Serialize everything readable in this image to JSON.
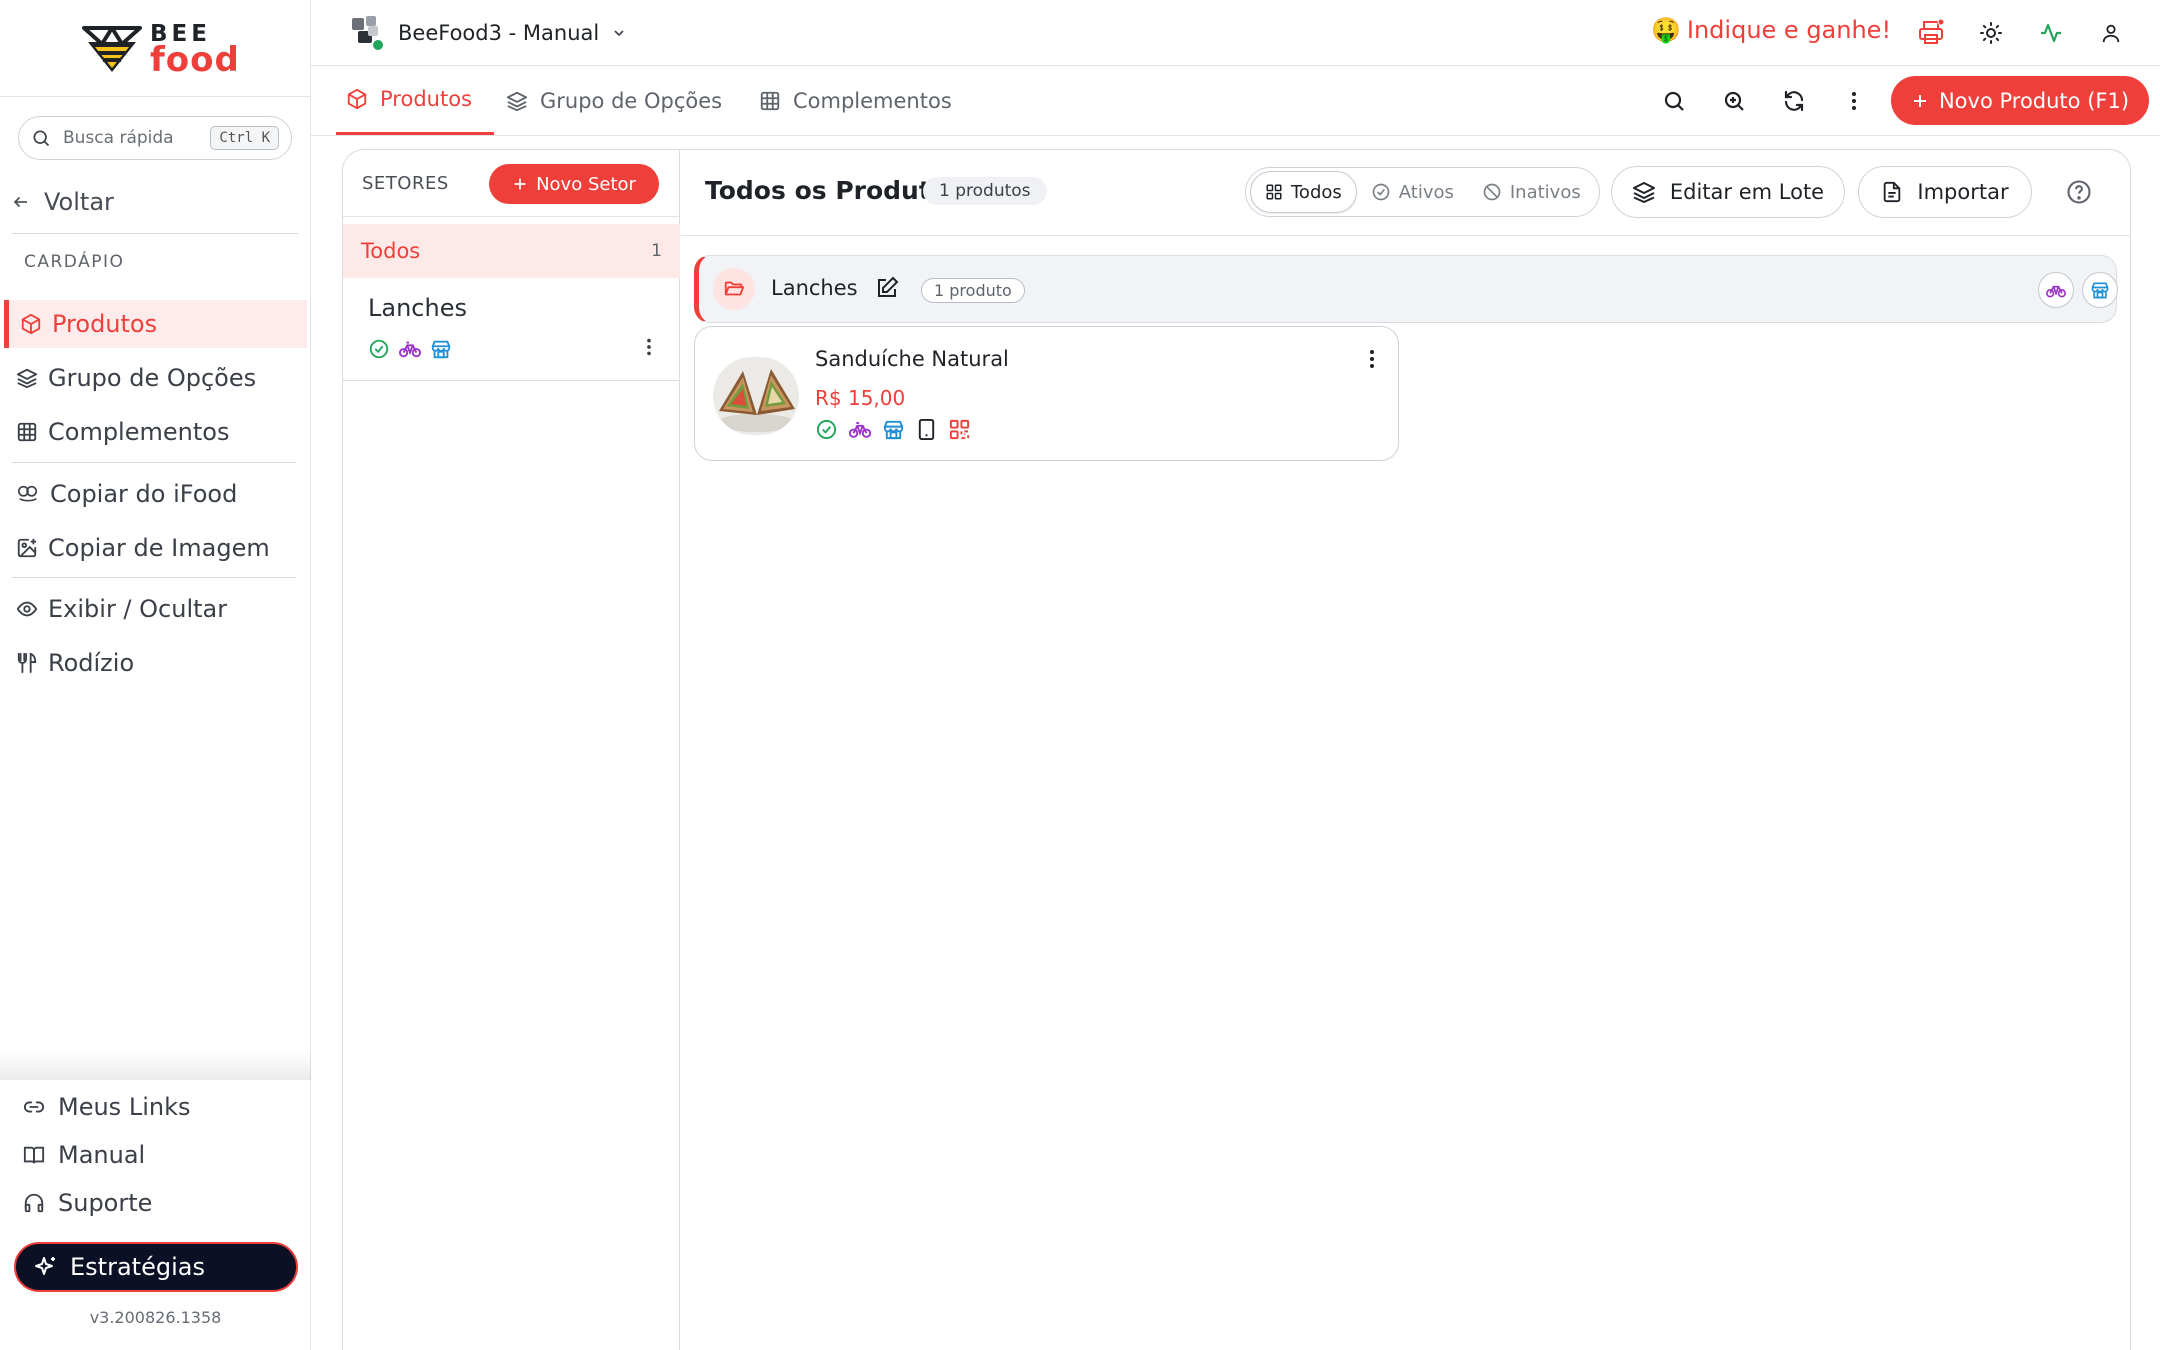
{
  "brand": {
    "top": "BEE",
    "bottom": "food"
  },
  "sidebar": {
    "search_label": "Busca rápida",
    "search_shortcut": "Ctrl K",
    "back": "Voltar",
    "section": "CARDÁPIO",
    "items": [
      {
        "label": "Produtos",
        "icon": "box-icon",
        "active": true
      },
      {
        "label": "Grupo de Opções",
        "icon": "layers-icon"
      },
      {
        "label": "Complementos",
        "icon": "grid-icon"
      },
      {
        "label": "Copiar do iFood",
        "icon": "ifood-icon"
      },
      {
        "label": "Copiar de Imagem",
        "icon": "image-add-icon"
      },
      {
        "label": "Exibir / Ocultar",
        "icon": "eye-icon"
      },
      {
        "label": "Rodízio",
        "icon": "utensils-icon"
      }
    ],
    "bottom": [
      {
        "label": "Meus Links",
        "icon": "link-icon"
      },
      {
        "label": "Manual",
        "icon": "book-icon"
      },
      {
        "label": "Suporte",
        "icon": "headset-icon"
      }
    ],
    "strategies": "Estratégias",
    "version": "v3.200826.1358"
  },
  "topbar": {
    "store": "BeeFood3 - Manual",
    "referral": "Indique e ganhe!",
    "referral_emoji": "🤑"
  },
  "tabs": [
    {
      "label": "Produtos",
      "icon": "box-icon",
      "active": true
    },
    {
      "label": "Grupo de Opções",
      "icon": "layers-icon"
    },
    {
      "label": "Complementos",
      "icon": "grid-icon"
    }
  ],
  "new_product": "Novo Produto (F1)",
  "sectors": {
    "title": "SETORES",
    "new_button": "Novo Setor",
    "all": {
      "label": "Todos",
      "count": "1"
    },
    "list": [
      {
        "name": "Lanches"
      }
    ]
  },
  "products": {
    "title": "Todos os Produtos",
    "count": "1 produtos",
    "filters": [
      {
        "label": "Todos",
        "active": true
      },
      {
        "label": "Ativos"
      },
      {
        "label": "Inativos"
      }
    ],
    "batch_edit": "Editar em Lote",
    "import": "Importar",
    "group": {
      "name": "Lanches",
      "count": "1 produto"
    },
    "items": [
      {
        "name": "Sanduíche Natural",
        "price": "R$ 15,00"
      }
    ]
  },
  "colors": {
    "accent": "#ef3f3a",
    "success": "#22a55b",
    "delivery": "#9b30c8",
    "store": "#1f8fd6"
  }
}
